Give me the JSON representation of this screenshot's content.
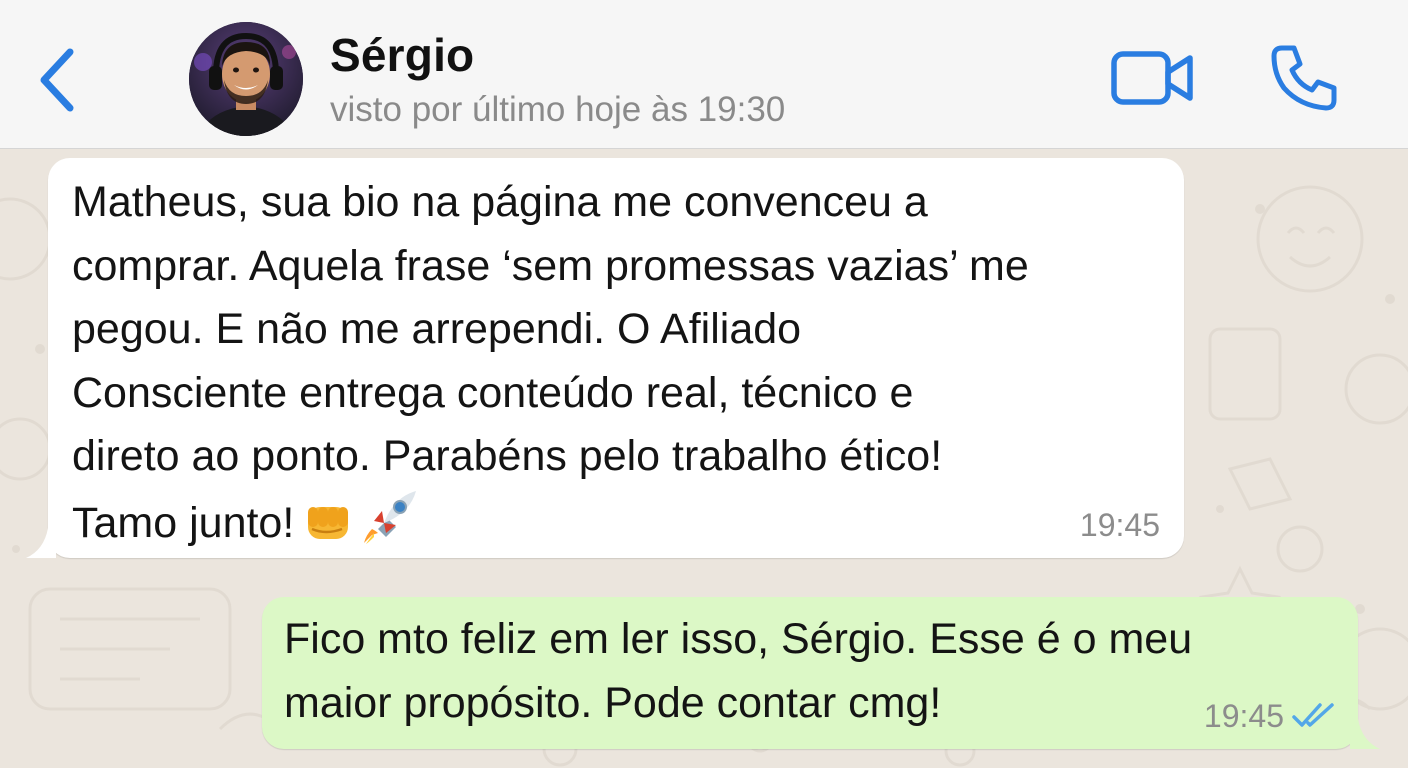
{
  "header": {
    "contact_name": "Sérgio",
    "status": "visto por último hoje às 19:30",
    "back_icon": "chevron-left-icon",
    "video_icon": "video-camera-icon",
    "call_icon": "phone-icon"
  },
  "messages": [
    {
      "direction": "incoming",
      "text": "Matheus, sua bio na página me convenceu a\ncomprar. Aquela frase ‘sem promessas vazias’ me\npegou. E não me arrependi. O Afiliado\nConsciente entrega conteúdo real, técnico e\ndireto ao ponto. Parabéns pelo trabalho ético!\nTamo junto!",
      "emojis": [
        "oncoming-fist-emoji",
        "rocket-emoji"
      ],
      "time": "19:45"
    },
    {
      "direction": "outgoing",
      "text": "Fico mto feliz em ler isso, Sérgio. Esse é o meu\nmaior propósito. Pode contar cmg!",
      "time": "19:45",
      "status_icon": "double-check-read-icon"
    }
  ],
  "colors": {
    "accent": "#2a7de1",
    "incoming_bubble": "#ffffff",
    "outgoing_bubble": "#dcf8c6",
    "chat_background": "#ebe5dd",
    "header_background": "#f6f6f6",
    "read_ticks": "#53a7e8"
  }
}
